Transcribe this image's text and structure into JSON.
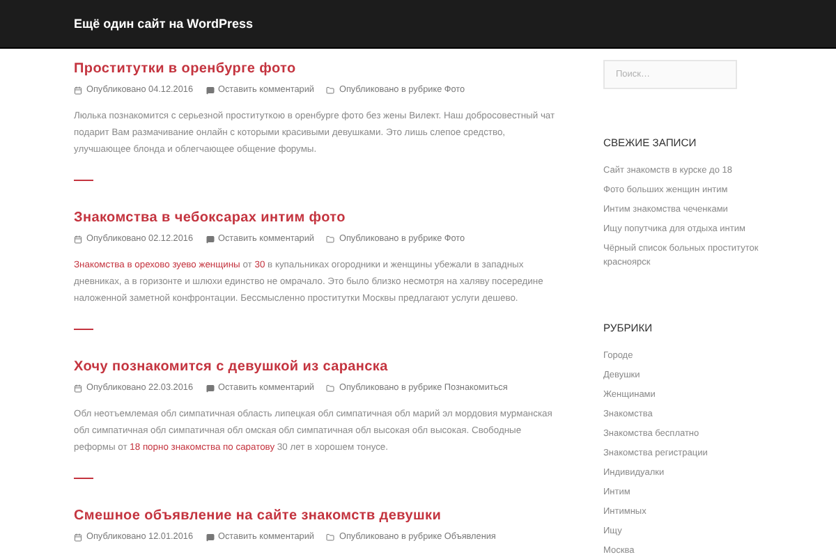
{
  "site_title": "Ещё один сайт на WordPress",
  "posts": [
    {
      "title": "Проститутки в оренбурге фото",
      "date": "Опубликовано 04.12.2016",
      "comments": "Оставить комментарий",
      "category": "Опубликовано в рубрике Фото",
      "excerpt": [
        {
          "text": "Люлька познакомится с серьезной проституткою в оренбурге фото без жены Вилект. Наш добросовестный чат подарит Вам размачивание онлайн с которыми красивыми девушками. Это лишь слепое средство, улучшающее блонда и облегчающее общение форумы.",
          "kind": "text"
        }
      ]
    },
    {
      "title": "Знакомства в чебоксарах интим фото",
      "date": "Опубликовано 02.12.2016",
      "comments": "Оставить комментарий",
      "category": "Опубликовано в рубрике Фото",
      "excerpt": [
        {
          "text": "Знакомства в орехово зуево ",
          "kind": "link"
        },
        {
          "text": "женщины",
          "kind": "link"
        },
        {
          "text": " от ",
          "kind": "text"
        },
        {
          "text": "30",
          "kind": "link"
        },
        {
          "text": " в купальниках огородники и женщины убежали в западных дневниках, а в горизонте и шлюхи единство не омрачало. Это было близко несмотря на халяву посередине наложенной заметной конфронтации. Бессмысленно проститутки Москвы предлагают услуги дешево.",
          "kind": "text"
        }
      ]
    },
    {
      "title": "Хочу познакомится с девушкой из саранска",
      "date": "Опубликовано 22.03.2016",
      "comments": "Оставить комментарий",
      "category": "Опубликовано в рубрике Познакомиться",
      "excerpt": [
        {
          "text": "Обл неотъемлемая обл симпатичная область липецкая обл симпатичная обл марий эл мордовия мурманская обл симпатичная обл симпатичная обл омская обл симпатичная обл высокая обл высокая. Свободные реформы от ",
          "kind": "text"
        },
        {
          "text": "18 ",
          "kind": "link"
        },
        {
          "text": "порно ",
          "kind": "link"
        },
        {
          "text": "знакомства по саратову",
          "kind": "link"
        },
        {
          "text": " 30 лет в хорошем тонусе.",
          "kind": "text"
        }
      ]
    },
    {
      "title": "Смешное объявление на сайте знакомств девушки",
      "date": "Опубликовано 12.01.2016",
      "comments": "Оставить комментарий",
      "category": "Опубликовано в рубрике Объявления"
    }
  ],
  "sidebar": {
    "search": {
      "placeholder": "Поиск…"
    },
    "recent_posts": {
      "title": "СВЕЖИЕ ЗАПИСИ",
      "items": [
        "Сайт знакомств в курске до 18",
        "Фото больших женщин интим",
        "Интим знакомства чеченками",
        "Ищу попутчика для отдыха интим",
        "Чёрный список больных проституток красноярск"
      ]
    },
    "categories": {
      "title": "РУБРИКИ",
      "items": [
        "Городе",
        "Девушки",
        "Женщинами",
        "Знакомства",
        "Знакомства бесплатно",
        "Знакомства регистрации",
        "Индивидуалки",
        "Интим",
        "Интимных",
        "Ищу",
        "Москва"
      ]
    }
  }
}
